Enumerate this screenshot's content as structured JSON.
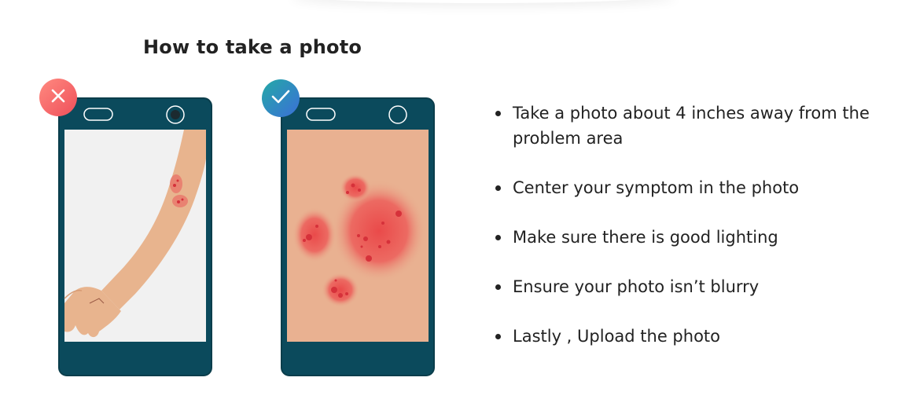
{
  "heading": "How to take a photo",
  "examples": [
    {
      "status": "incorrect",
      "icon": "x-mark-icon",
      "color_from": "#ff8a80",
      "color_to": "#ef4f5a"
    },
    {
      "status": "correct",
      "icon": "checkmark-icon",
      "color_from": "#24a9a6",
      "color_to": "#3b6fd8"
    }
  ],
  "phone_color": "#0b4a5c",
  "tips": [
    "Take a photo about 4 inches away from the problem area",
    "Center your symptom in the photo",
    "Make sure there is good lighting",
    "Ensure your photo isn’t blurry",
    "Lastly , Upload the photo"
  ]
}
